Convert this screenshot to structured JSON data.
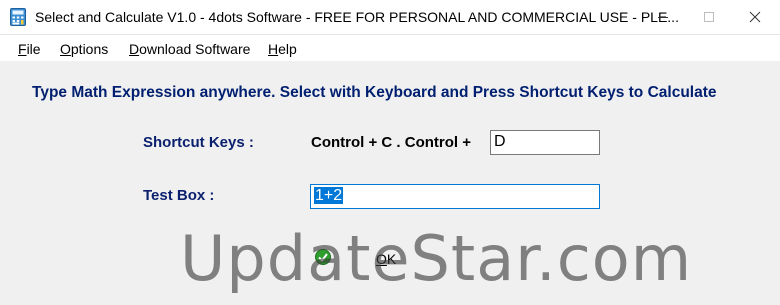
{
  "window": {
    "title": "Select and Calculate V1.0 - 4dots Software - FREE FOR PERSONAL AND COMMERCIAL USE - PLE...",
    "icon": "calculator-icon"
  },
  "menu": {
    "items": [
      {
        "accel": "F",
        "rest": "ile"
      },
      {
        "accel": "O",
        "rest": "ptions"
      },
      {
        "accel": "D",
        "rest": "ownload Software"
      },
      {
        "accel": "H",
        "rest": "elp"
      }
    ]
  },
  "main": {
    "headline": "Type Math Expression anywhere. Select with Keyboard and Press Shortcut Keys to Calculate",
    "shortcut_label": "Shortcut Keys :",
    "shortcut_prefix": "Control + C . Control +",
    "shortcut_key_value": "D",
    "test_box_label": "Test Box :",
    "test_box_value": "1+2",
    "ok_label_accel": "O",
    "ok_label_rest": "K",
    "ok_icon": "checkmark-icon"
  },
  "watermark": "UpdateStar.com",
  "colors": {
    "label_blue": "#0a1f6e",
    "selection": "#0078d7",
    "ok_green": "#2e9e2e"
  }
}
